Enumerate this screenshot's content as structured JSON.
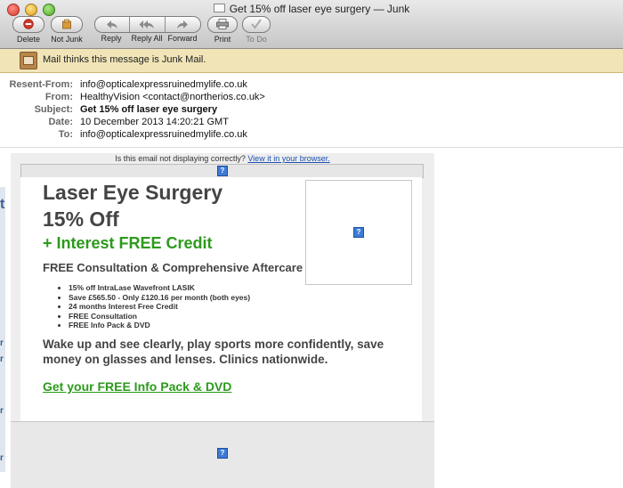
{
  "window": {
    "title": "Get 15% off laser eye surgery — Junk"
  },
  "toolbar": {
    "delete_label": "Delete",
    "not_junk_label": "Not Junk",
    "reply_label": "Reply",
    "reply_all_label": "Reply All",
    "forward_label": "Forward",
    "print_label": "Print",
    "todo_label": "To Do"
  },
  "junk_banner": {
    "text": "Mail thinks this message is Junk Mail."
  },
  "header": {
    "resent_from_label": "Resent-From:",
    "resent_from": "info@opticalexpressruinedmylife.co.uk",
    "from_label": "From:",
    "from": "HealthyVision <contact@northerios.co.uk>",
    "subject_label": "Subject:",
    "subject": "Get 15% off laser eye surgery",
    "date_label": "Date:",
    "date": "10 December 2013 14:20:21 GMT",
    "to_label": "To:",
    "to": "info@opticalexpressruinedmylife.co.uk"
  },
  "email": {
    "notice_text": "Is this email not displaying correctly?",
    "notice_link": "View it in your browser.",
    "placeholder_glyph": "?",
    "headline_1": "Laser Eye Surgery",
    "headline_2": "15% Off",
    "headline_green": "+ Interest FREE Credit",
    "subheading": "FREE Consultation & Comprehensive Aftercare",
    "bullets": [
      "15% off IntraLase Wavefront LASIK",
      "Save £565.50 - Only £120.16 per month (both eyes)",
      "24 months Interest Free Credit",
      "FREE Consultation",
      "FREE Info Pack & DVD"
    ],
    "paragraph": "Wake up and see clearly, play sports more confidently, save money on glasses and lenses. Clinics nationwide.",
    "cta": "Get your FREE Info Pack & DVD"
  },
  "sidebar_peek": {
    "glyphs": [
      "t",
      "r",
      "r",
      "r",
      "r"
    ]
  },
  "colors": {
    "green": "#2c9a1c",
    "junk_banner": "#f1e5b8",
    "link_blue": "#1a4fb0"
  }
}
